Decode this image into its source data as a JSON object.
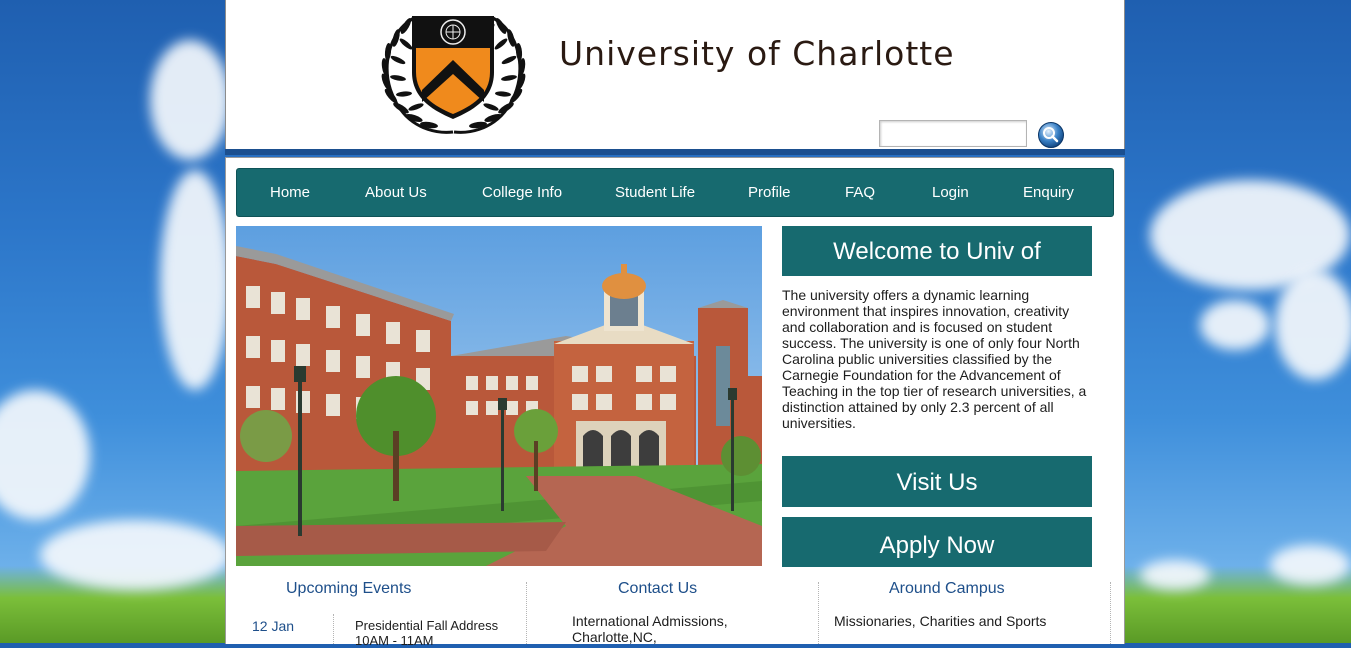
{
  "header": {
    "title": "University of Charlotte",
    "search": {
      "value": "",
      "placeholder": ""
    }
  },
  "nav": {
    "items": [
      "Home",
      "About Us",
      "College Info",
      "Student Life",
      "Profile",
      "FAQ",
      "Login",
      "Enquiry"
    ]
  },
  "welcome": {
    "heading": "Welcome to Univ of Charlotte",
    "body": "The university offers a dynamic learning environment that inspires innovation, creativity and collaboration and is focused on student success. The university is one of only four North Carolina public universities classified by the Carnegie Foundation for the Advancement of Teaching in the top tier of research universities, a distinction attained by only 2.3 percent of all universities."
  },
  "cta": {
    "visit": "Visit Us",
    "apply": "Apply Now"
  },
  "events": {
    "title": "Upcoming Events",
    "date": "12 Jan",
    "event_line1": "Presidential Fall Address",
    "event_line2": "10AM - 11AM"
  },
  "contact": {
    "title": "Contact Us",
    "line1": "International Admissions,",
    "line2": "Charlotte,NC,"
  },
  "campus": {
    "title": "Around Campus",
    "line1": "Missionaries, Charities and Sports"
  },
  "colors": {
    "accent": "#176a6f",
    "link": "#1e4f8a",
    "shield_orange": "#f08a1c"
  },
  "icons": [
    "university-crest-logo",
    "search-icon"
  ]
}
